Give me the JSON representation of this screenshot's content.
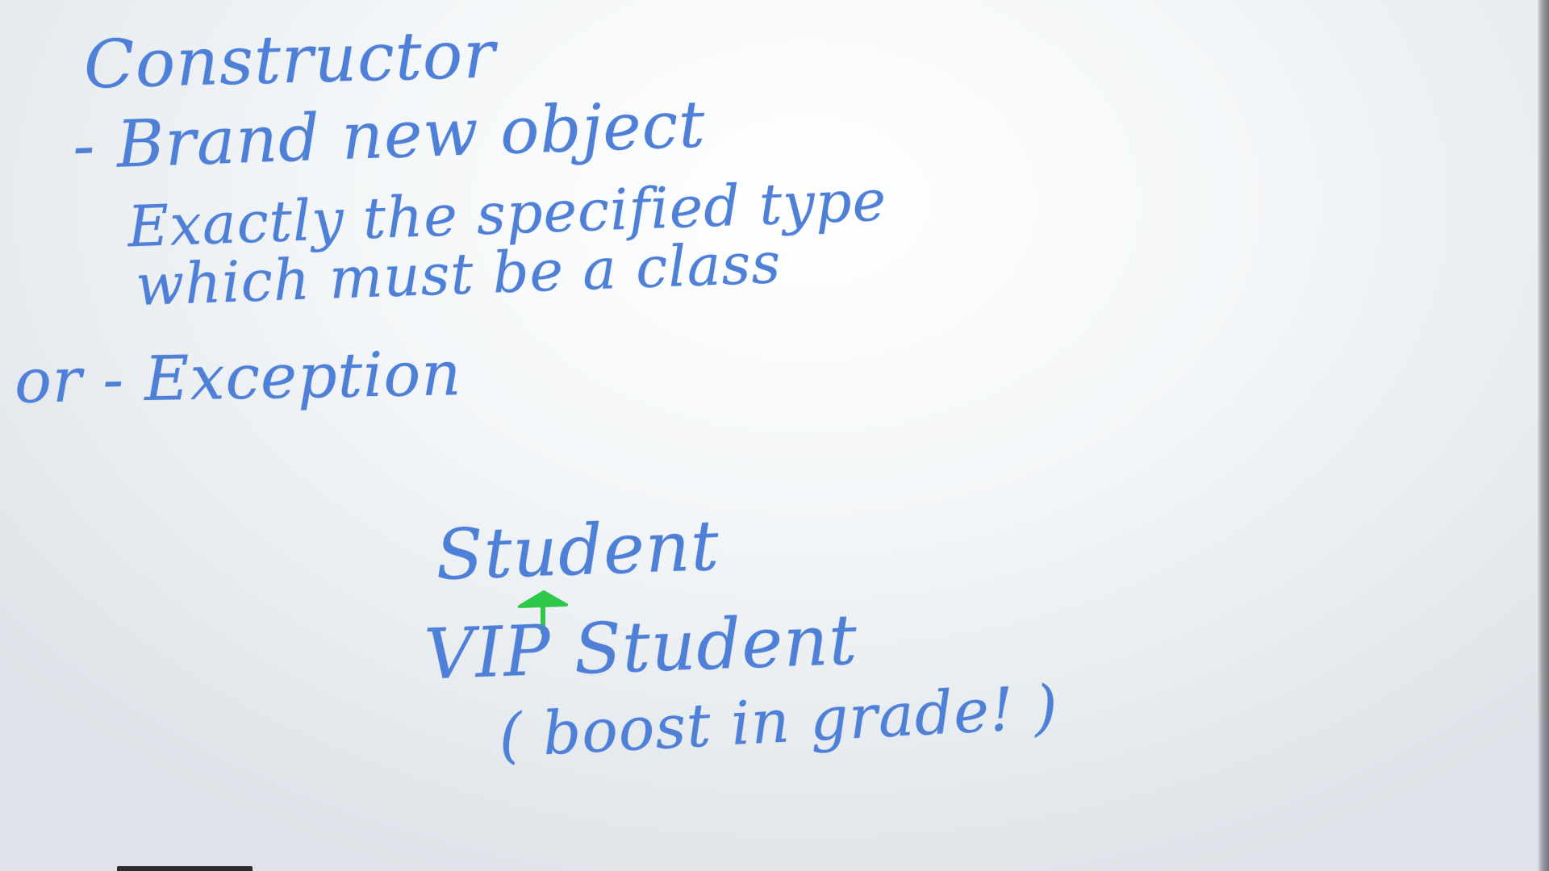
{
  "whiteboard": {
    "title": "Constructor",
    "lines": [
      "- Brand new object",
      "Exactly the specified type",
      "which must be a class",
      "or - Exception"
    ],
    "diagram": {
      "superclass": "Student",
      "subclass": "VIP Student",
      "note": "( boost in grade! )",
      "arrow_color": "#2fc84a"
    },
    "ink_color": "#4f80d8"
  }
}
